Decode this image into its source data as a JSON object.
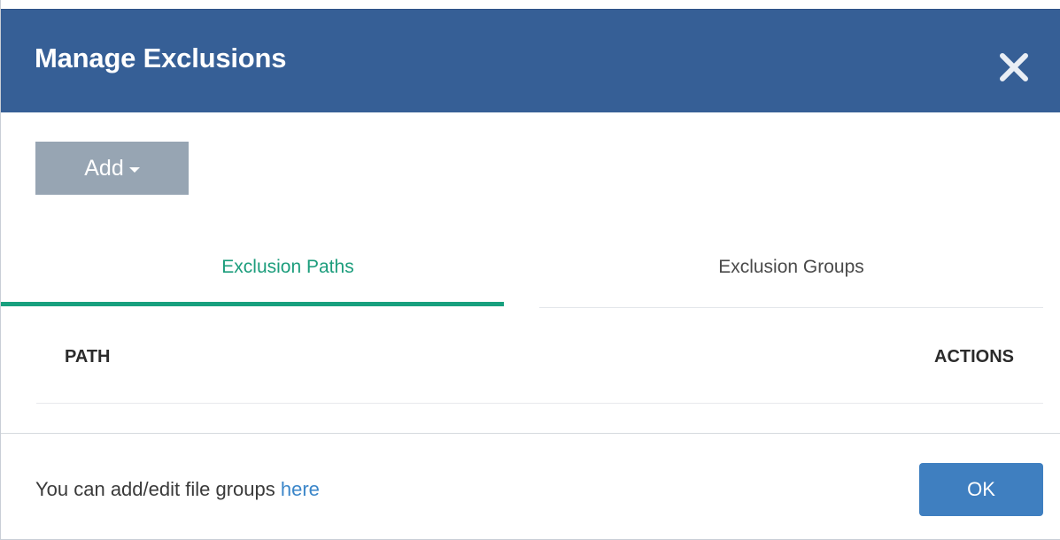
{
  "dialog": {
    "title": "Manage Exclusions"
  },
  "toolbar": {
    "add_label": "Add"
  },
  "tabs": [
    {
      "label": "Exclusion Paths",
      "active": true
    },
    {
      "label": "Exclusion Groups",
      "active": false
    }
  ],
  "table": {
    "columns": [
      "PATH",
      "ACTIONS"
    ],
    "rows": []
  },
  "footer": {
    "text_prefix": "You can add/edit file groups ",
    "link_label": "here",
    "ok_label": "OK"
  },
  "colors": {
    "header_bg": "#365f96",
    "active_tab": "#1c9d7c",
    "add_button": "#97a5b3",
    "ok_button": "#3f7fc0",
    "link": "#3b86c9"
  },
  "icons": {
    "close": "close-icon",
    "add_caret": "caret-down-icon"
  }
}
